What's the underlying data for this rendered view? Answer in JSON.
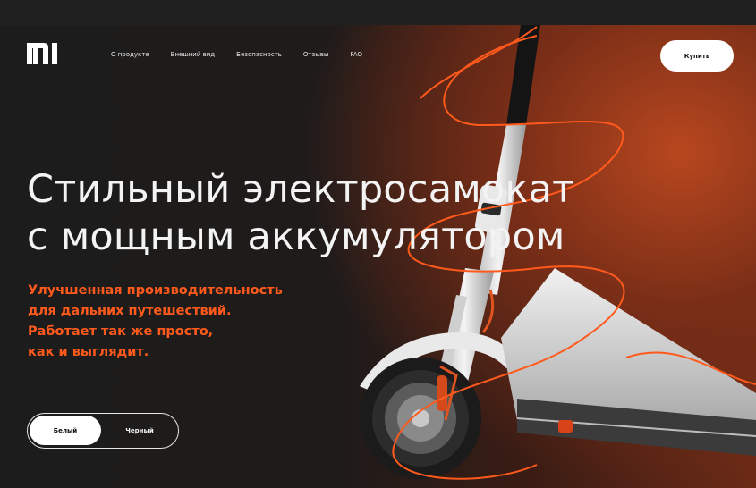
{
  "header": {
    "logo_text": "mi",
    "nav": [
      "О продукте",
      "Внешний вид",
      "Безопасность",
      "Отзывы",
      "FAQ"
    ],
    "buy_label": "Купить"
  },
  "hero": {
    "title_line1": "Стильный электросамокат",
    "title_line2": "с мощным аккумулятором",
    "subtitle_lines": [
      "Улучшенная производительность",
      "для дальних путешествий.",
      "Работает так же просто,",
      "как и выглядит."
    ]
  },
  "color_toggle": {
    "options": [
      "Белый",
      "Черный"
    ],
    "selected": "Белый"
  },
  "colors": {
    "accent": "#ff5a1c",
    "background": "#1d1d1d",
    "glow": "#b8471f"
  }
}
